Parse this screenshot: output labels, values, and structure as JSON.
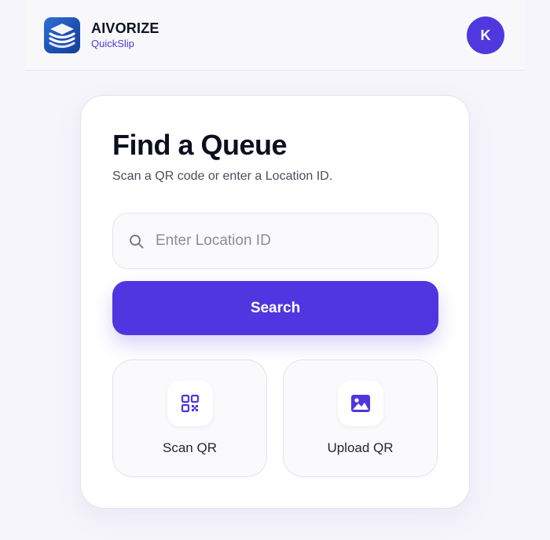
{
  "header": {
    "brand_name": "AIVORIZE",
    "brand_sub": "QuickSlip",
    "avatar_initial": "K"
  },
  "card": {
    "title": "Find a Queue",
    "subtitle": "Scan a QR code or enter a Location ID.",
    "search_input": {
      "value": "",
      "placeholder": "Enter Location ID",
      "icon": "search-icon"
    },
    "search_button": "Search",
    "actions": [
      {
        "label": "Scan QR",
        "icon": "qr-code-icon"
      },
      {
        "label": "Upload QR",
        "icon": "image-icon"
      }
    ]
  },
  "colors": {
    "accent": "#4f36e0",
    "avatar": "#4f38de",
    "brand_sub": "#4f3bd9",
    "background": "#f6f5fb"
  }
}
